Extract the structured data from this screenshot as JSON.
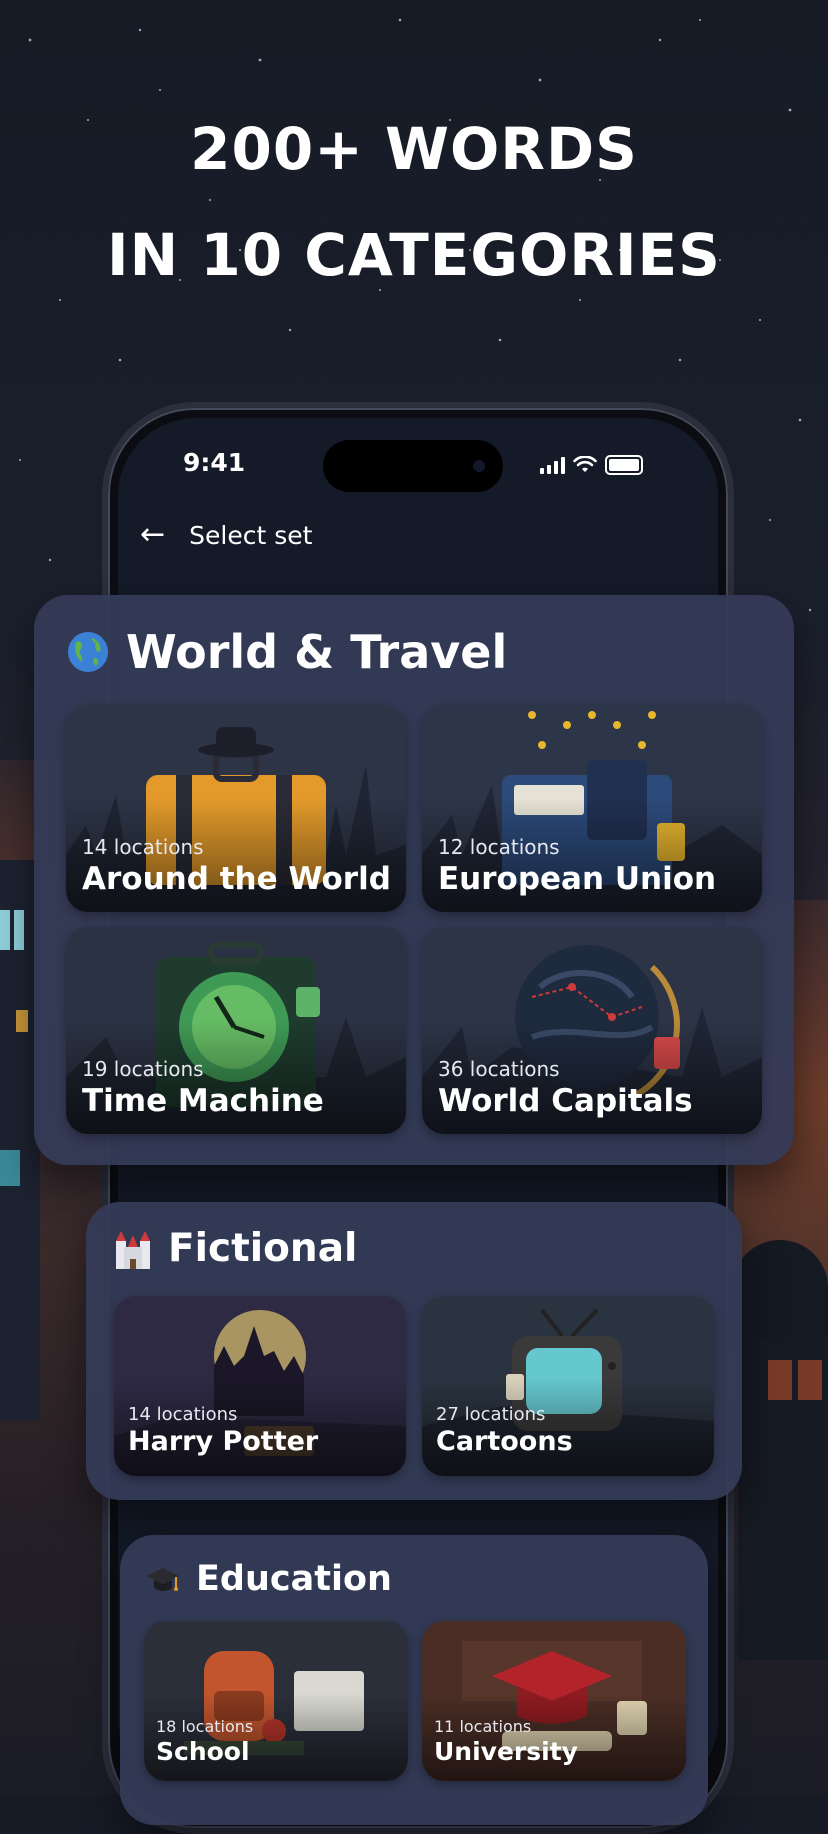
{
  "headline": {
    "line1": "200+ WORDS",
    "line2": "IN 10 CATEGORIES"
  },
  "status_bar": {
    "time": "9:41"
  },
  "nav": {
    "title": "Select set"
  },
  "sections": [
    {
      "title": "World & Travel",
      "icon": "globe-icon",
      "cards": [
        {
          "count": "14 locations",
          "name": "Around the World",
          "art": "suitcase"
        },
        {
          "count": "12 locations",
          "name": "European Union",
          "art": "passport"
        },
        {
          "count": "19 locations",
          "name": "Time Machine",
          "art": "clock"
        },
        {
          "count": "36 locations",
          "name": "World Capitals",
          "art": "globe"
        }
      ]
    },
    {
      "title": "Fictional",
      "icon": "castle-icon",
      "cards": [
        {
          "count": "14 locations",
          "name": "Harry Potter",
          "art": "castle"
        },
        {
          "count": "27 locations",
          "name": "Cartoons",
          "art": "tv"
        }
      ]
    },
    {
      "title": "Education",
      "icon": "graduation-cap-icon",
      "cards": [
        {
          "count": "18 locations",
          "name": "School",
          "art": "backpack"
        },
        {
          "count": "11 locations",
          "name": "University",
          "art": "cap"
        }
      ]
    }
  ],
  "colors": {
    "panel": "#343a56",
    "accent": "#e39a2a"
  }
}
